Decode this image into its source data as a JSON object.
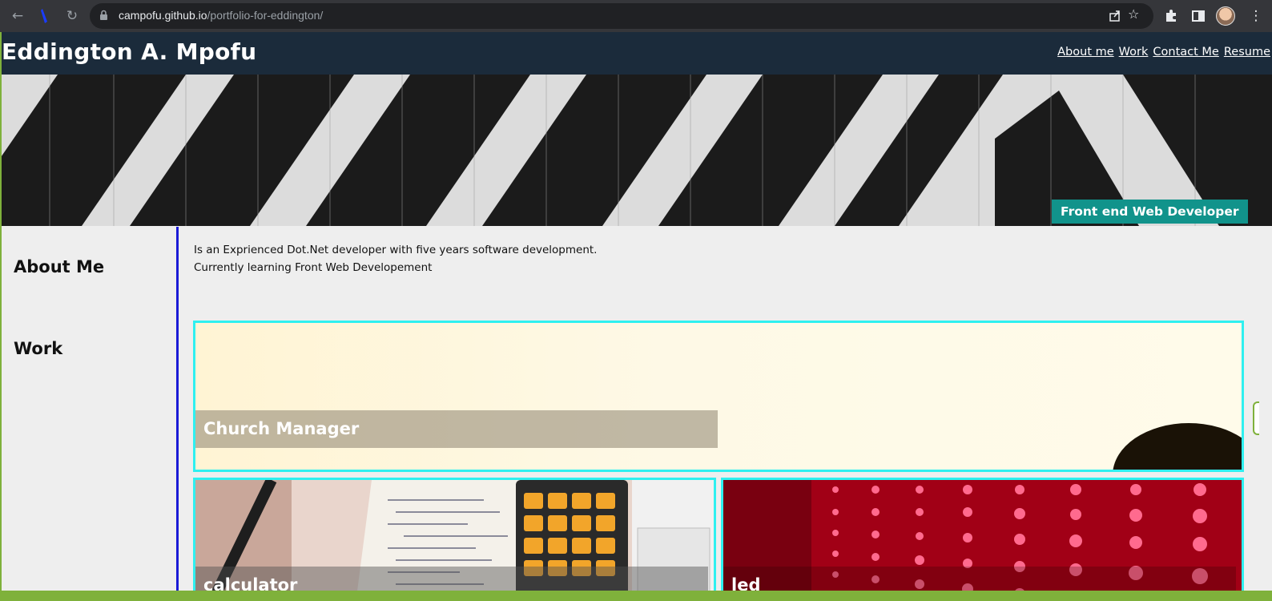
{
  "browser": {
    "url_host": "campofu.github.io",
    "url_path": "/portfolio-for-eddington/"
  },
  "site": {
    "title": "Eddington A. Mpofu",
    "nav": [
      "About me",
      "Work",
      "Contact Me",
      "Resume"
    ],
    "hero_badge": "Front end Web Developer"
  },
  "about": {
    "heading": "About Me",
    "lines": [
      "Is an Exprienced Dot.Net developer with five years software development.",
      "Currently learning Front Web Developement"
    ]
  },
  "work": {
    "heading": "Work",
    "projects": [
      "Church Manager",
      "calculator",
      "led"
    ]
  },
  "colors": {
    "header_bg": "#1b2b3b",
    "badge_bg": "#11938b",
    "card_border": "#2ff0f0",
    "divider": "#1a1ad6"
  }
}
